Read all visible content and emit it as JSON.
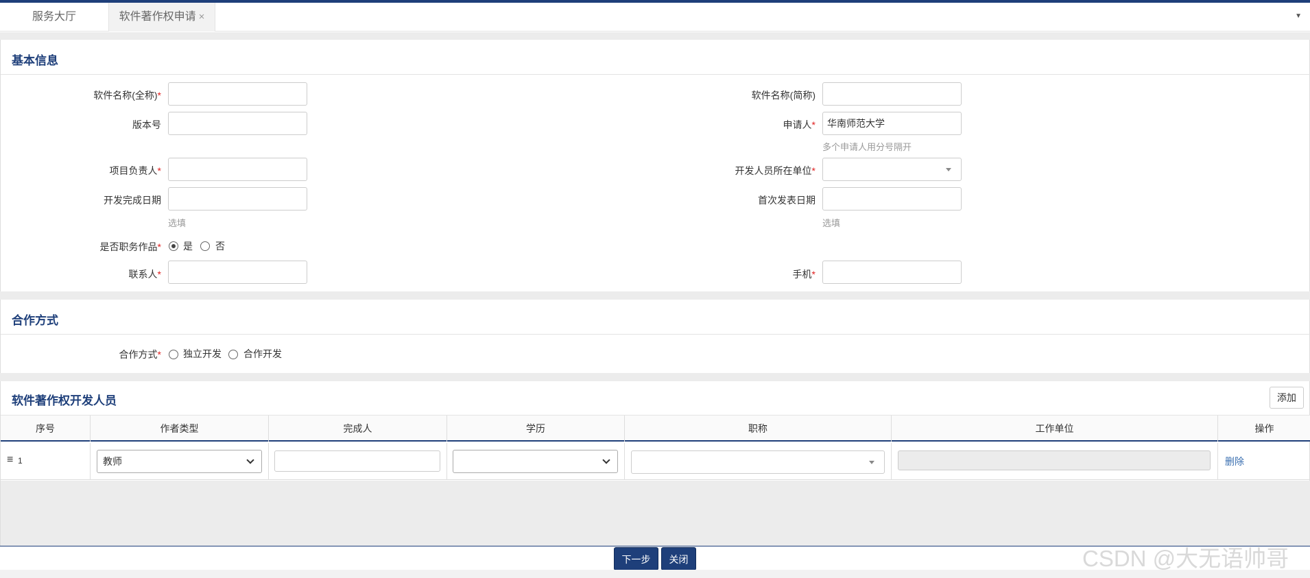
{
  "tabs": [
    {
      "label": "服务大厅"
    },
    {
      "label": "软件著作权申请",
      "close": "×"
    }
  ],
  "sections": {
    "basic": "基本信息",
    "coop": "合作方式",
    "devs": "软件著作权开发人员"
  },
  "form": {
    "software_full_name": {
      "label": "软件名称(全称)",
      "value": ""
    },
    "software_short_name": {
      "label": "软件名称(简称)",
      "value": ""
    },
    "version": {
      "label": "版本号",
      "value": ""
    },
    "applicant": {
      "label": "申请人",
      "value": "华南师范大学",
      "hint": "多个申请人用分号隔开"
    },
    "project_leader": {
      "label": "项目负责人",
      "value": ""
    },
    "dev_unit": {
      "label": "开发人员所在单位",
      "value": ""
    },
    "dev_finish_date": {
      "label": "开发完成日期",
      "value": "",
      "hint": "选填"
    },
    "first_publish_date": {
      "label": "首次发表日期",
      "value": "",
      "hint": "选填"
    },
    "is_work_for_hire": {
      "label": "是否职务作品",
      "options": [
        "是",
        "否"
      ],
      "selected": "是"
    },
    "contact": {
      "label": "联系人",
      "value": ""
    },
    "mobile": {
      "label": "手机",
      "value": ""
    },
    "required_mark": "*"
  },
  "coop": {
    "label": "合作方式",
    "options": [
      "独立开发",
      "合作开发"
    ],
    "selected": ""
  },
  "devs": {
    "add_button": "添加",
    "columns": [
      "序号",
      "作者类型",
      "完成人",
      "学历",
      "职称",
      "工作单位",
      "操作"
    ],
    "rows": [
      {
        "index": "1",
        "author_type": "教师",
        "name": "",
        "education": "",
        "title": "",
        "unit": "",
        "action": "删除"
      }
    ]
  },
  "footer": {
    "next": "下一步",
    "close": "关闭"
  },
  "watermark": "CSDN @大无语帅哥"
}
